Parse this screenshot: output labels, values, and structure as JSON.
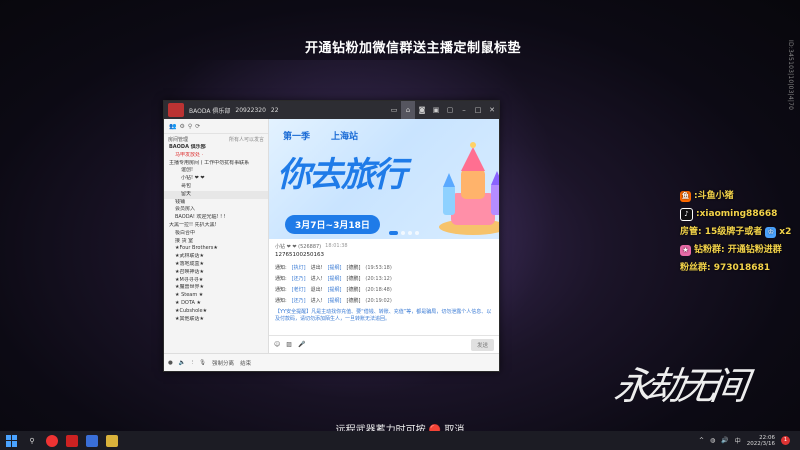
{
  "stream": {
    "top_banner": "开通钻粉加微信群送主播定制鼠标垫",
    "side_id": "ID:345103|10|03|4|70",
    "subtitle": "远程武器蓄力时可按 🔴 取消",
    "calligraphy": "永劫无间"
  },
  "app_window": {
    "title": "BAODA 俱乐部",
    "room_id": "20922320",
    "online": "22",
    "titlebar_icons": [
      "video-icon",
      "home-icon",
      "camera-icon",
      "game-icon",
      "window-icon",
      "minimize-icon",
      "maximize-icon",
      "close-icon"
    ],
    "left_header": {
      "label": "房间管理",
      "action": "所有人可以发言"
    },
    "tree": [
      {
        "text": "BAODA 俱乐部",
        "level": 0,
        "style": "bold"
      },
      {
        "text": "马甲发放处 ·",
        "level": 1,
        "style": "red"
      },
      {
        "text": "主播专用房间 ( 工作中勿扰有事联系",
        "level": 0,
        "style": ""
      },
      {
        "text": "谊创!",
        "level": 2,
        "style": ""
      },
      {
        "text": "小钻! ❤ ❤",
        "level": 2,
        "style": ""
      },
      {
        "text": "哥包",
        "level": 2,
        "style": ""
      },
      {
        "text": "留天",
        "level": 2,
        "style": "sel"
      },
      {
        "text": "钱铺",
        "level": 1,
        "style": ""
      },
      {
        "text": "会员房入",
        "level": 1,
        "style": ""
      },
      {
        "text": "BAODA! 欢迎光临! ! !",
        "level": 1,
        "style": ""
      },
      {
        "text": "大黑一拉!! 先扒大黑!",
        "level": 0,
        "style": ""
      },
      {
        "text": "极白合中",
        "level": 1,
        "style": ""
      },
      {
        "text": "接 货 室",
        "level": 1,
        "style": ""
      },
      {
        "text": "★Four Brothers★",
        "level": 1,
        "style": ""
      },
      {
        "text": "★武林联话★",
        "level": 1,
        "style": ""
      },
      {
        "text": "★落地成盒★",
        "level": 1,
        "style": ""
      },
      {
        "text": "★召唤神话★",
        "level": 1,
        "style": ""
      },
      {
        "text": "★M寻寻寻★",
        "level": 1,
        "style": ""
      },
      {
        "text": "★魔兽世界★",
        "level": 1,
        "style": ""
      },
      {
        "text": "★ Steam ★",
        "level": 1,
        "style": ""
      },
      {
        "text": "★ DOTA ★",
        "level": 1,
        "style": ""
      },
      {
        "text": "★Cubshole★",
        "level": 1,
        "style": ""
      },
      {
        "text": "★其他联话★",
        "level": 1,
        "style": ""
      }
    ],
    "banner": {
      "season": "第一季",
      "station": "上海站",
      "headline": "你去旅行",
      "dates": "3月7日~3月18日"
    },
    "chat": {
      "sender": "小钻 ❤ ❤ (526887)",
      "time": "18:01:38",
      "message": "12765100250163",
      "notices": [
        {
          "label": "通知:",
          "user": "[执灯]",
          "action": "进出!",
          "extra": "[提纲]",
          "dept": "[德鹏]",
          "time": "(19:53:18)"
        },
        {
          "label": "通知:",
          "user": "[还乃]",
          "action": "进入!",
          "extra": "[提纲]",
          "dept": "[德鹏]",
          "time": "(20:13:12)"
        },
        {
          "label": "通知:",
          "user": "[老灯]",
          "action": "退出!",
          "extra": "[提纲]",
          "dept": "[德鹏]",
          "time": "(20:18:48)"
        },
        {
          "label": "通知:",
          "user": "[还乃]",
          "action": "进入!",
          "extra": "[提纲]",
          "dept": "[德鹏]",
          "time": "(20:19:02)"
        }
      ],
      "system": "【YY安全提醒】凡是主动找你充值、要“借钱、转账、充值”等，都是骗局，切勿泄露个人信息、以及付款码，请切勿添加陌生人，一旦转账无法追回。"
    },
    "composer": {
      "send_label": "发送"
    },
    "bottom_bar": [
      "强制分离",
      "结束"
    ]
  },
  "overlay_info": [
    {
      "icon": "douyu-icon",
      "text": ":斗鱼小猪"
    },
    {
      "icon": "tiktok-icon",
      "text": ":xiaoming88668"
    },
    {
      "icon": "crown-icon",
      "text": "房管: 15级牌子或者",
      "suffix": "x2"
    },
    {
      "icon": "fan-icon",
      "text": "钻粉群: 开通钻粉进群"
    },
    {
      "icon": "",
      "text": "粉丝群: 973018681"
    }
  ],
  "taskbar": {
    "icons": [
      "search-icon",
      "chrome-icon",
      "app-icon",
      "recorder-icon",
      "game-icon"
    ],
    "tray_lang": "中",
    "time": "22:06",
    "date": "2022/3/16",
    "notifications": "1"
  }
}
